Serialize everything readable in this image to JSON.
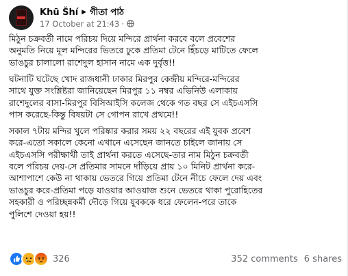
{
  "post": {
    "author": "Khū Šhí",
    "group": "গীতা পাঠ",
    "timestamp": "17 October at 21:43",
    "separator": "·",
    "privacy_icon": "globe-icon",
    "paragraphs": [
      [
        "মিঠুন চক্রবর্তী নামে পরিচয় দিয়ে মন্দিরে প্রার্থনা করবে বলে প্রবেশের",
        "অনুমতি নিয়ে মূল মন্দিরের ভিতরে ঢুকে প্রতিমা টেনে হিঁচড়ে মাটিতে ফেলে",
        "ভাঙচুর চালালো রাশেদুল হাসান নামে এক দুর্বৃত্ত!!"
      ],
      [
        "ঘটনাটি ঘটেছে খোদ রাজধানী ঢাকার মিরপুর কেন্দ্রীয় মন্দিরে-মন্দিরের",
        "সাথে যুক্ত সংশ্লিষ্টরা জানিয়েছেন মিরপুর ১১ নম্বর এভিনিউ এলাকায়",
        "রাশেদুলের বাসা-মিরপুর বিসিআইসি কলেজ থেকে গত বছর সে এইচএসসি",
        "পাস করেছে-কিন্তু বিষয়টা সে গোপন রাখে প্রথমে!!"
      ],
      [
        "সকাল ৭টায় মন্দির খুলে পরিষ্কার করার সময় ২২ বছরের এই যুবক প্রবেশ",
        "করে-এতো সকালে কেনো এখানে এসেছেন  জানতে চাইলে জানায় সে",
        "এইচএসসি পরীক্ষার্থী তাই প্রার্থনা করতে এসেছে-তার নাম মিঠুন চক্রবর্তী",
        "বলে পরিচয় দেয়-সে প্রতিমার সামনে দাঁড়িয়ে প্রায় ১০ মিনিট প্রার্থনা করে-",
        "আশাপাশে কেউ না থাকায় ভেতরে গিয়ে প্রতিমা টেনে নীচে ফেলে দেয় এবং",
        "ভাঙচুর করে-প্রতিমা পড়ে যাওয়ার আওয়াজ শুনে ভেতরে থাকা পুরোহিতের",
        "সহকারী ও পরিচ্ছন্নকর্মী দৌড়ে গিয়ে যুবককে ধরে ফেলেন-পরে তাকে",
        "পুলিশে দেওয়া হয়!!"
      ]
    ]
  },
  "footer": {
    "reaction_icons": [
      "like-icon",
      "sad-icon",
      "angry-icon"
    ],
    "reaction_count": "326",
    "comments": "352 comments",
    "shares": "6 shares"
  },
  "colors": {
    "text": "#050505",
    "secondary": "#65676b",
    "like": "#1877f2",
    "sad": "#f7b125",
    "angry": "#e9710f"
  }
}
